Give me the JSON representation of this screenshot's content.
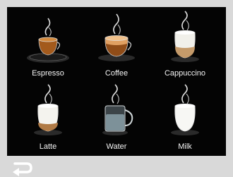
{
  "drinks": [
    {
      "label": "Espresso",
      "icon": "espresso-cup-icon"
    },
    {
      "label": "Coffee",
      "icon": "coffee-cup-icon"
    },
    {
      "label": "Cappuccino",
      "icon": "cappuccino-glass-icon"
    },
    {
      "label": "Latte",
      "icon": "latte-glass-icon"
    },
    {
      "label": "Water",
      "icon": "water-mug-icon"
    },
    {
      "label": "Milk",
      "icon": "milk-glass-icon"
    }
  ],
  "colors": {
    "background": "#040404",
    "frame": "#d9d9d9",
    "coffee": "#a35a1c",
    "milk": "#f1f0ea"
  },
  "back_icon": "back-arrow-icon"
}
